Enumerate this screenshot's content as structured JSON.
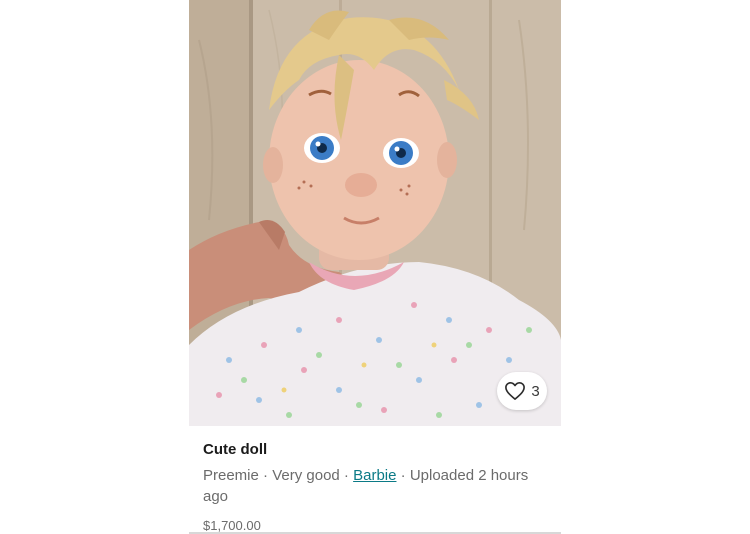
{
  "listing": {
    "title": "Cute doll",
    "size": "Preemie",
    "condition": "Very good",
    "brand": "Barbie",
    "uploaded": "Uploaded 2 hours ago",
    "separator": " · ",
    "price": "$1,700.00",
    "likes": "3"
  },
  "icons": {
    "like": "heart-outline-icon"
  },
  "colors": {
    "brand_link": "#0b7a86",
    "secondary_text": "#6b6b6b",
    "title_text": "#1b1b1b"
  }
}
